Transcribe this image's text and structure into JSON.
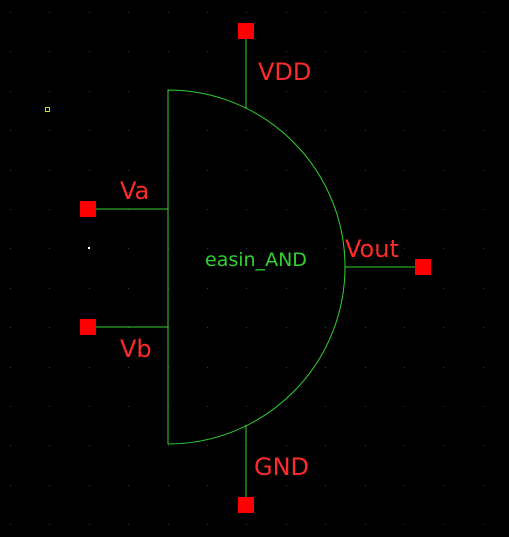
{
  "symbol": {
    "cell_name": "easin_AND"
  },
  "pins": {
    "vdd": "VDD",
    "va": "Va",
    "vb": "Vb",
    "vout": "Vout",
    "gnd": "GND"
  },
  "colors": {
    "background": "#000000",
    "grid_dot": "#3a3a3a",
    "wire": "#2fd12f",
    "pin": "#ff0000",
    "pin_label": "#ff2a2a",
    "cell_label": "#2fd12f",
    "marker": "#d8d800",
    "origin_dot": "#ffffff"
  }
}
